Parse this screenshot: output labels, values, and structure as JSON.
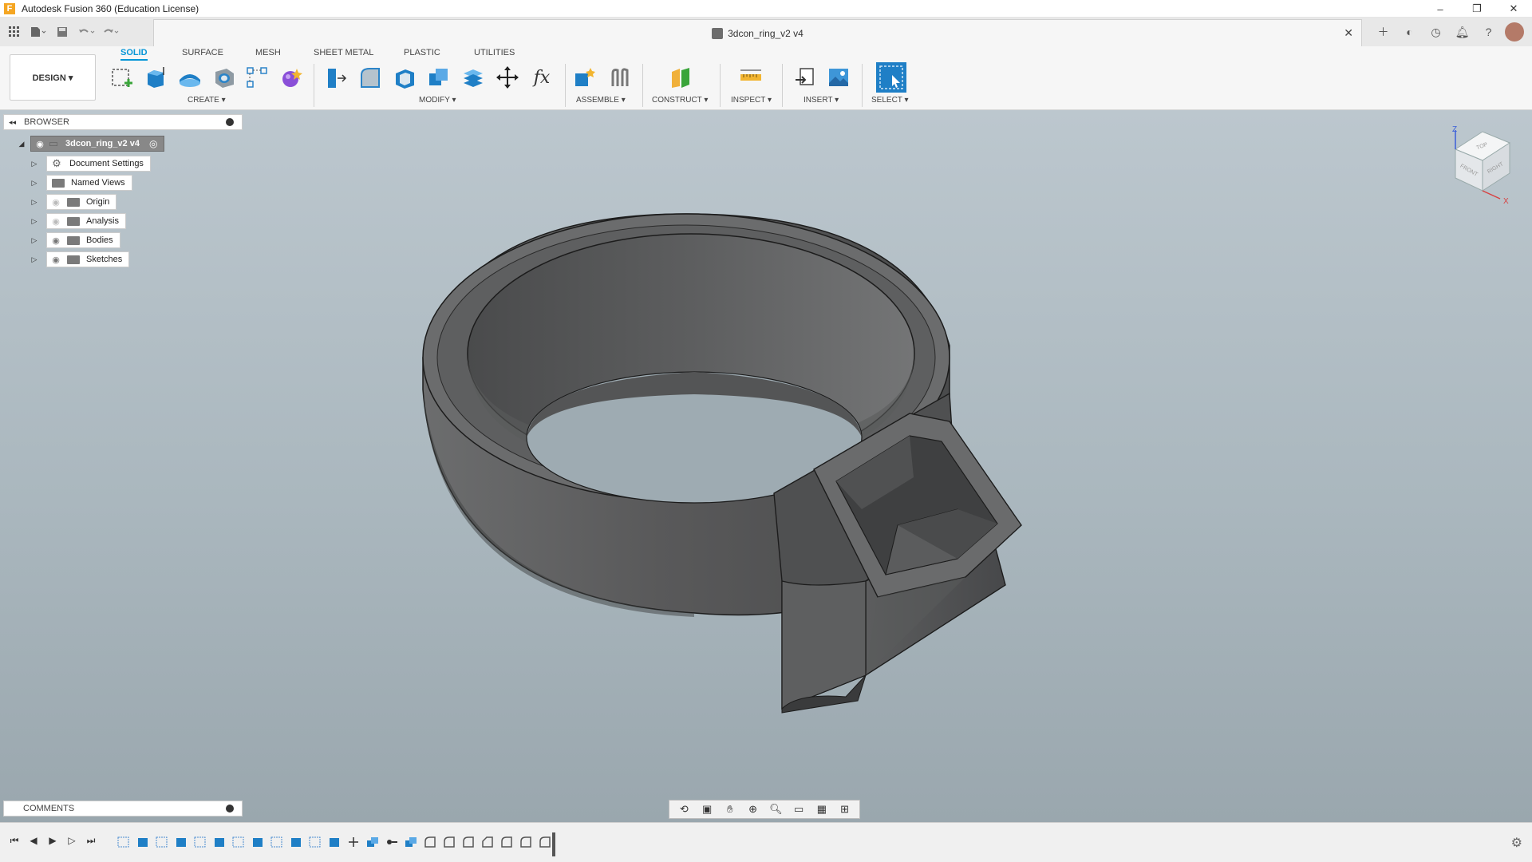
{
  "window": {
    "title": "Autodesk Fusion 360 (Education License)",
    "controls": [
      "–",
      "❐",
      "✕"
    ]
  },
  "document": {
    "tab_title": "3dcon_ring_v2 v4"
  },
  "workspace": {
    "label": "DESIGN ▾"
  },
  "ribbon": {
    "tabs": [
      "SOLID",
      "SURFACE",
      "MESH",
      "SHEET METAL",
      "PLASTIC",
      "UTILITIES"
    ],
    "active_tab": "SOLID",
    "groups": [
      "CREATE ▾",
      "MODIFY ▾",
      "ASSEMBLE ▾",
      "CONSTRUCT ▾",
      "INSPECT ▾",
      "INSERT ▾",
      "SELECT ▾"
    ]
  },
  "browser": {
    "header": "BROWSER",
    "root": "3dcon_ring_v2 v4",
    "items": [
      "Document Settings",
      "Named Views",
      "Origin",
      "Analysis",
      "Bodies",
      "Sketches"
    ]
  },
  "comments": {
    "label": "COMMENTS"
  },
  "viewcube": {
    "faces": [
      "TOP",
      "FRONT",
      "RIGHT"
    ],
    "axes": [
      "Z",
      "X"
    ]
  },
  "colors": {
    "accent": "#0696d7",
    "model": "#5c5d5e",
    "viewport_top": "#bcc7ce",
    "viewport_bottom": "#9aa7ae"
  }
}
